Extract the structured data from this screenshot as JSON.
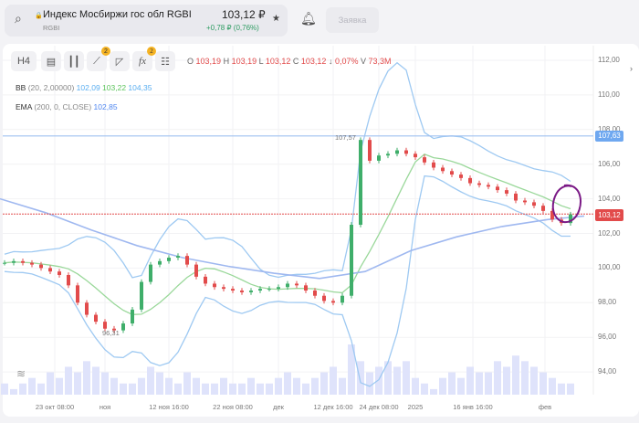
{
  "header": {
    "title": "Индекс Мосбиржи гос обл RGBI",
    "ticker": "RGBI",
    "price": "103,12 ₽",
    "change": "+0,78 ₽ (0,76%)",
    "order_button": "Заявка"
  },
  "toolbar": {
    "interval": "H4",
    "draw_badge": "2",
    "fx_badge": "2"
  },
  "ohlc": {
    "o_label": "O",
    "o": "103,19",
    "h_label": "H",
    "h": "103,19",
    "l_label": "L",
    "l": "103,12",
    "c_label": "C",
    "c": "103,12",
    "arrow": "↓",
    "chg": "0,07%",
    "v_label": "V",
    "v": "73,3M"
  },
  "indicators": {
    "bb_label": "BB",
    "bb_params": "(20, 2,00000)",
    "bb_lower": "102,09",
    "bb_mid": "103,22",
    "bb_upper": "104,35",
    "ema_label": "EMA",
    "ema_params": "(200, 0, CLOSE)",
    "ema_value": "102,85"
  },
  "colors": {
    "up": "#3fae6a",
    "down": "#e24b4b",
    "bb": "#9ec9f2",
    "bb_mid": "#9ad89a",
    "ema": "#9fb8f0",
    "annotation": "#7b1a86"
  },
  "chart_data": {
    "type": "candlestick",
    "y_ticks": [
      "112,00",
      "110,00",
      "108,00",
      "106,00",
      "104,00",
      "102,00",
      "100,00",
      "98,00",
      "96,00",
      "94,00"
    ],
    "ylim": [
      93.5,
      112.5
    ],
    "x_ticks": [
      "23 окт 08:00",
      "ноя",
      "12 ноя 16:00",
      "22 ноя 08:00",
      "дек",
      "12 дек 16:00",
      "24 дек 08:00",
      "2025",
      "16 янв 16:00",
      "фев"
    ],
    "closes": [
      100.3,
      100.4,
      100.3,
      100.2,
      100.0,
      99.8,
      99.6,
      99.0,
      98.0,
      97.3,
      96.9,
      96.5,
      96.4,
      96.8,
      97.6,
      99.2,
      100.2,
      100.4,
      100.6,
      100.7,
      100.2,
      99.5,
      99.1,
      98.9,
      98.8,
      98.7,
      98.6,
      98.7,
      98.8,
      98.8,
      98.9,
      99.1,
      99.0,
      98.7,
      98.4,
      98.1,
      98.0,
      98.4,
      102.5,
      107.4,
      106.2,
      106.5,
      106.6,
      106.8,
      106.6,
      106.4,
      106.1,
      105.8,
      105.6,
      105.4,
      105.2,
      104.9,
      104.8,
      104.7,
      104.5,
      104.3,
      103.9,
      103.8,
      103.6,
      103.3,
      102.8,
      102.6,
      103.1
    ],
    "ema": [
      104,
      103.2,
      102.2,
      101.3,
      100.6,
      100.1,
      99.7,
      99.4,
      99.8,
      101.0,
      101.8,
      102.4,
      102.8,
      103.0
    ],
    "volumes": [
      2,
      1,
      2,
      3,
      2,
      4,
      3,
      5,
      4,
      6,
      5,
      4,
      3,
      2,
      2,
      3,
      5,
      4,
      3,
      2,
      4,
      3,
      2,
      2,
      3,
      2,
      2,
      3,
      2,
      2,
      3,
      4,
      3,
      2,
      3,
      4,
      5,
      3,
      9,
      6,
      4,
      5,
      6,
      5,
      6,
      3,
      2,
      1,
      3,
      4,
      3,
      5,
      4,
      4,
      6,
      5,
      7,
      6,
      5,
      4,
      3,
      2,
      2
    ],
    "last_price": "103,12",
    "level_price": "107,63",
    "high_label": "107,57",
    "low_label": "96,31"
  }
}
